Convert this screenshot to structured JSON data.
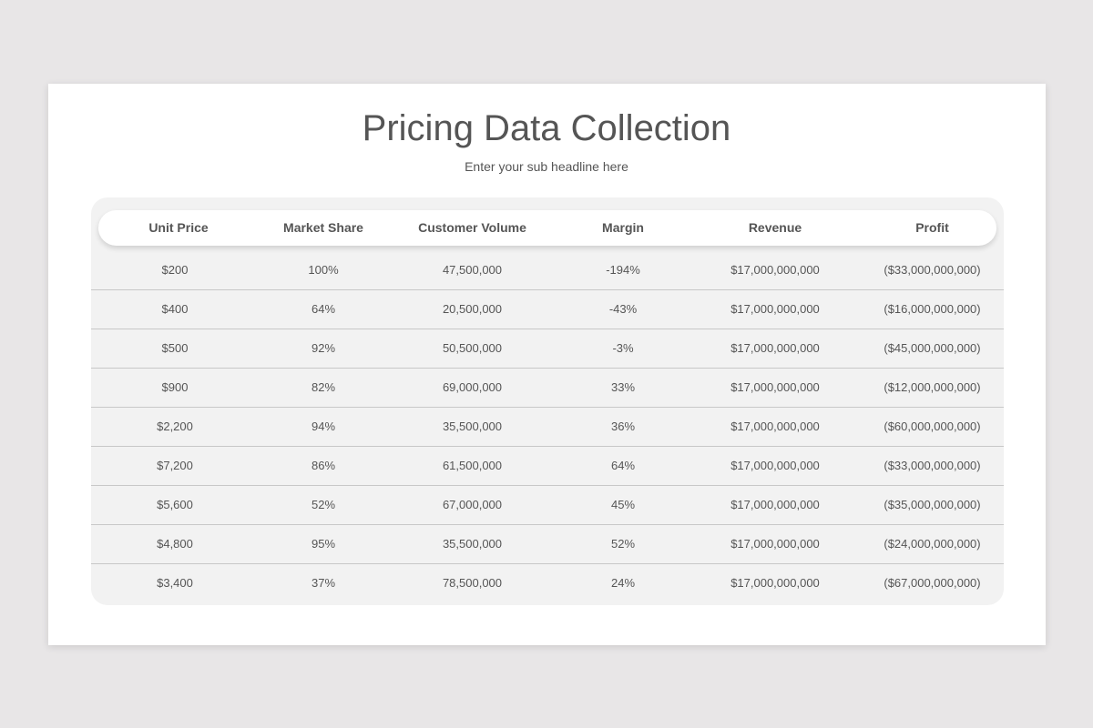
{
  "slide": {
    "title": "Pricing Data Collection",
    "subtitle": "Enter your sub headline here"
  },
  "table": {
    "headers": [
      "Unit Price",
      "Market Share",
      "Customer Volume",
      "Margin",
      "Revenue",
      "Profit"
    ],
    "rows": [
      [
        "$200",
        "100%",
        "47,500,000",
        "-194%",
        "$17,000,000,000",
        "($33,000,000,000)"
      ],
      [
        "$400",
        "64%",
        "20,500,000",
        "-43%",
        "$17,000,000,000",
        "($16,000,000,000)"
      ],
      [
        "$500",
        "92%",
        "50,500,000",
        "-3%",
        "$17,000,000,000",
        "($45,000,000,000)"
      ],
      [
        "$900",
        "82%",
        "69,000,000",
        "33%",
        "$17,000,000,000",
        "($12,000,000,000)"
      ],
      [
        "$2,200",
        "94%",
        "35,500,000",
        "36%",
        "$17,000,000,000",
        "($60,000,000,000)"
      ],
      [
        "$7,200",
        "86%",
        "61,500,000",
        "64%",
        "$17,000,000,000",
        "($33,000,000,000)"
      ],
      [
        "$5,600",
        "52%",
        "67,000,000",
        "45%",
        "$17,000,000,000",
        "($35,000,000,000)"
      ],
      [
        "$4,800",
        "95%",
        "35,500,000",
        "52%",
        "$17,000,000,000",
        "($24,000,000,000)"
      ],
      [
        "$3,400",
        "37%",
        "78,500,000",
        "24%",
        "$17,000,000,000",
        "($67,000,000,000)"
      ]
    ]
  },
  "colors": {
    "background": "#e8e6e7",
    "card": "#ffffff",
    "panel": "#f2f2f2",
    "text": "#555555",
    "divider": "#c8c8c8"
  }
}
